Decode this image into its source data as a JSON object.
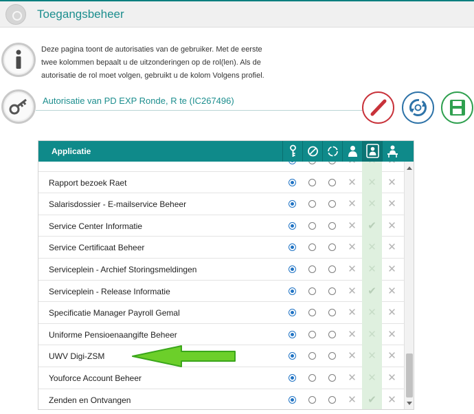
{
  "app": {
    "title": "Toegangsbeheer"
  },
  "info": {
    "text": "Deze pagina toont de autorisaties van de gebruiker. Met de eerste twee kolommen bepaalt u de uitzonderingen op de rol(len). Als de autorisatie de rol moet volgen, gebruikt u de kolom Volgens profiel."
  },
  "subject": {
    "text": "Autorisatie van PD EXP Ronde, R te (IC267496)"
  },
  "actions": {
    "edit_icon": "pencil-icon",
    "refresh_icon": "refresh-icon",
    "save_icon": "save-icon"
  },
  "grid": {
    "header_title": "Applicatie",
    "column_icons": [
      "key-icon",
      "blocked-icon",
      "circle-icon",
      "user-icon",
      "user-badge-icon",
      "user-desk-icon"
    ],
    "rows": [
      {
        "label": "",
        "selected": 0,
        "profile": "x"
      },
      {
        "label": "Rapport bezoek Raet",
        "selected": 0,
        "profile": "x"
      },
      {
        "label": "Salarisdossier - E-mailservice Beheer",
        "selected": 0,
        "profile": "x"
      },
      {
        "label": "Service Center Informatie",
        "selected": 0,
        "profile": "check"
      },
      {
        "label": "Service Certificaat Beheer",
        "selected": 0,
        "profile": "x"
      },
      {
        "label": "Serviceplein - Archief Storingsmeldingen",
        "selected": 0,
        "profile": "x"
      },
      {
        "label": "Serviceplein - Release Informatie",
        "selected": 0,
        "profile": "check"
      },
      {
        "label": "Specificatie Manager Payroll Gemal",
        "selected": 0,
        "profile": "x"
      },
      {
        "label": "Uniforme Pensioenaangifte Beheer",
        "selected": 0,
        "profile": "x"
      },
      {
        "label": "UWV Digi-ZSM",
        "selected": 0,
        "profile": "x"
      },
      {
        "label": "Youforce Account Beheer",
        "selected": 0,
        "profile": "x"
      },
      {
        "label": "Zenden en Ontvangen",
        "selected": 0,
        "profile": "check"
      }
    ]
  },
  "colors": {
    "accent": "#0f8a8a",
    "title_teal": "#1c8e8e",
    "edit_red": "#c8323a",
    "refresh_blue": "#2e73a8",
    "save_green": "#2fa04f",
    "arrow_green": "#6ccf2a",
    "highlight_column": "#dff0df"
  }
}
